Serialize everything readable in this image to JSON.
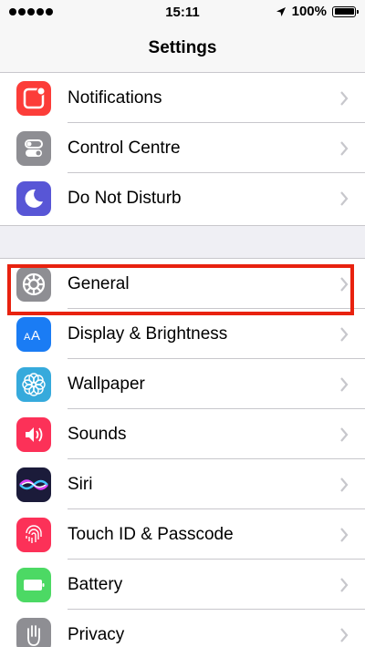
{
  "status_bar": {
    "time": "15:11",
    "battery_percent": "100%",
    "icons": [
      "signal-dots-icon",
      "location-arrow-icon",
      "battery-icon"
    ]
  },
  "nav": {
    "title": "Settings"
  },
  "groups": [
    {
      "items": [
        {
          "label": "Notifications",
          "icon": "notifications-icon",
          "color": "#fc3d39"
        },
        {
          "label": "Control Centre",
          "icon": "control-centre-icon",
          "color": "#8e8e93"
        },
        {
          "label": "Do Not Disturb",
          "icon": "moon-icon",
          "color": "#5856d6"
        }
      ]
    },
    {
      "items": [
        {
          "label": "General",
          "icon": "gear-icon",
          "color": "#8e8e93",
          "highlighted": true
        },
        {
          "label": "Display & Brightness",
          "icon": "display-brightness-icon",
          "color": "#1a7cf4"
        },
        {
          "label": "Wallpaper",
          "icon": "wallpaper-flower-icon",
          "color": "#36aadc"
        },
        {
          "label": "Sounds",
          "icon": "speaker-icon",
          "color": "#fc3158"
        },
        {
          "label": "Siri",
          "icon": "siri-icon",
          "color": "#1b1b3a"
        },
        {
          "label": "Touch ID & Passcode",
          "icon": "fingerprint-icon",
          "color": "#fc3158"
        },
        {
          "label": "Battery",
          "icon": "battery-green-icon",
          "color": "#4cd964"
        },
        {
          "label": "Privacy",
          "icon": "hand-icon",
          "color": "#8e8e93"
        }
      ]
    }
  ],
  "highlight_color": "#e8220f"
}
